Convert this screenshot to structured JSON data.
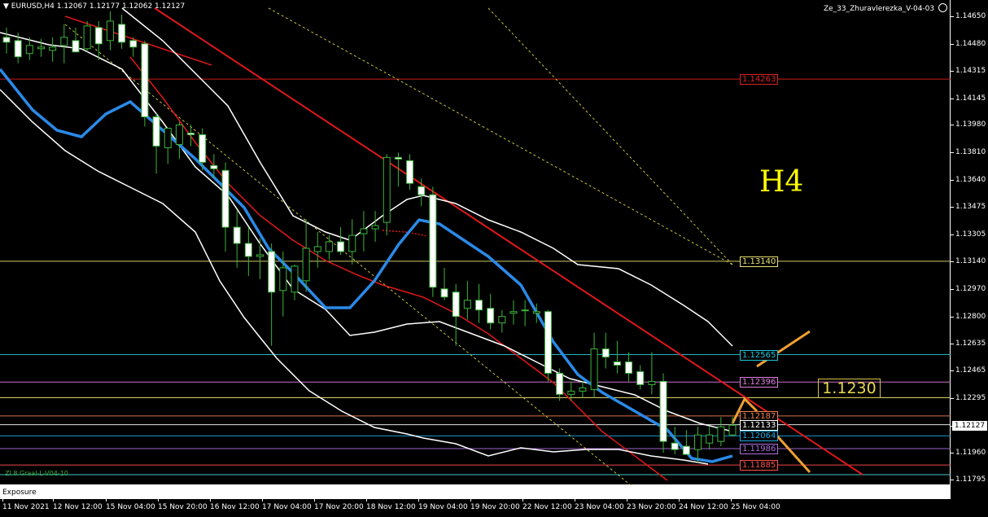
{
  "header": {
    "arrow": "▼",
    "symbol": "EURUSD,H4",
    "ohlc": "1.12067 1.12177 1.12062 1.12127"
  },
  "indicator": {
    "name": "Ze_33_Zhuravlerezka_V-04-03",
    "icon": "smiley-icon"
  },
  "timeframe_label": "H4",
  "target_label": "1.1230",
  "current_price": "1.12127",
  "indicator_label": "ZI 8 Graal-L-V04-10",
  "sub_panel": {
    "tab": "Exposure"
  },
  "price_axis": {
    "ticks": [
      "1.14650",
      "1.14480",
      "1.14315",
      "1.14145",
      "1.13980",
      "1.13810",
      "1.13640",
      "1.13475",
      "1.13305",
      "1.13140",
      "1.12970",
      "1.12800",
      "1.12635",
      "1.12465",
      "1.12295",
      "1.12127",
      "1.11960",
      "1.11795"
    ]
  },
  "levels": [
    {
      "value": "1.14263",
      "color": "#e02020"
    },
    {
      "value": "1.13140",
      "color": "#e8e070"
    },
    {
      "value": "1.12565",
      "color": "#20c8d8"
    },
    {
      "value": "1.12396",
      "color": "#e080e0"
    },
    {
      "value": "1.12187",
      "color": "#f08050"
    },
    {
      "value": "1.12133",
      "color": "#ffffff"
    },
    {
      "value": "1.12064",
      "color": "#20a8e0"
    },
    {
      "value": "1.11986",
      "color": "#b070e0"
    },
    {
      "value": "1.11885",
      "color": "#ff5050"
    }
  ],
  "time_axis": [
    "11 Nov 2021",
    "12 Nov 12:00",
    "15 Nov 04:00",
    "15 Nov 20:00",
    "16 Nov 12:00",
    "17 Nov 04:00",
    "17 Nov 20:00",
    "18 Nov 12:00",
    "19 Nov 04:00",
    "19 Nov 20:00",
    "22 Nov 12:00",
    "23 Nov 04:00",
    "23 Nov 20:00",
    "24 Nov 12:00",
    "25 Nov 04:00"
  ],
  "chart_data": {
    "type": "candlestick",
    "symbol": "EURUSD",
    "timeframe": "H4",
    "ylim": [
      1.1176,
      1.1475
    ],
    "candles": [
      {
        "o": 1.1452,
        "h": 1.1458,
        "l": 1.1442,
        "c": 1.1449
      },
      {
        "o": 1.145,
        "h": 1.1455,
        "l": 1.1436,
        "c": 1.144
      },
      {
        "o": 1.1442,
        "h": 1.1452,
        "l": 1.1438,
        "c": 1.1447
      },
      {
        "o": 1.1445,
        "h": 1.1451,
        "l": 1.144,
        "c": 1.1446
      },
      {
        "o": 1.1444,
        "h": 1.1452,
        "l": 1.1437,
        "c": 1.1446
      },
      {
        "o": 1.1447,
        "h": 1.146,
        "l": 1.1436,
        "c": 1.1452
      },
      {
        "o": 1.145,
        "h": 1.1458,
        "l": 1.1443,
        "c": 1.1443
      },
      {
        "o": 1.1445,
        "h": 1.1462,
        "l": 1.1443,
        "c": 1.1459
      },
      {
        "o": 1.1458,
        "h": 1.1462,
        "l": 1.1438,
        "c": 1.1448
      },
      {
        "o": 1.145,
        "h": 1.1468,
        "l": 1.1444,
        "c": 1.1462
      },
      {
        "o": 1.146,
        "h": 1.1466,
        "l": 1.1445,
        "c": 1.1449
      },
      {
        "o": 1.145,
        "h": 1.1452,
        "l": 1.144,
        "c": 1.1446
      },
      {
        "o": 1.1448,
        "h": 1.145,
        "l": 1.1397,
        "c": 1.1403
      },
      {
        "o": 1.1403,
        "h": 1.1405,
        "l": 1.1368,
        "c": 1.1385
      },
      {
        "o": 1.1384,
        "h": 1.1395,
        "l": 1.1374,
        "c": 1.1396
      },
      {
        "o": 1.1386,
        "h": 1.14,
        "l": 1.1377,
        "c": 1.1398
      },
      {
        "o": 1.1393,
        "h": 1.1398,
        "l": 1.1385,
        "c": 1.1392
      },
      {
        "o": 1.1392,
        "h": 1.1396,
        "l": 1.137,
        "c": 1.1375
      },
      {
        "o": 1.1373,
        "h": 1.138,
        "l": 1.1365,
        "c": 1.1371
      },
      {
        "o": 1.137,
        "h": 1.1375,
        "l": 1.132,
        "c": 1.1335
      },
      {
        "o": 1.1335,
        "h": 1.1345,
        "l": 1.131,
        "c": 1.1325
      },
      {
        "o": 1.1325,
        "h": 1.1335,
        "l": 1.1305,
        "c": 1.1317
      },
      {
        "o": 1.1317,
        "h": 1.1328,
        "l": 1.1303,
        "c": 1.1318
      },
      {
        "o": 1.132,
        "h": 1.1325,
        "l": 1.1262,
        "c": 1.1295
      },
      {
        "o": 1.1296,
        "h": 1.132,
        "l": 1.128,
        "c": 1.131
      },
      {
        "o": 1.1295,
        "h": 1.1312,
        "l": 1.129,
        "c": 1.1311
      },
      {
        "o": 1.1302,
        "h": 1.134,
        "l": 1.1295,
        "c": 1.1322
      },
      {
        "o": 1.132,
        "h": 1.1332,
        "l": 1.131,
        "c": 1.1323
      },
      {
        "o": 1.132,
        "h": 1.133,
        "l": 1.1315,
        "c": 1.1326
      },
      {
        "o": 1.1326,
        "h": 1.1335,
        "l": 1.1318,
        "c": 1.132
      },
      {
        "o": 1.132,
        "h": 1.134,
        "l": 1.1312,
        "c": 1.133
      },
      {
        "o": 1.1331,
        "h": 1.1345,
        "l": 1.132,
        "c": 1.1334
      },
      {
        "o": 1.1334,
        "h": 1.1345,
        "l": 1.1326,
        "c": 1.1336
      },
      {
        "o": 1.1338,
        "h": 1.138,
        "l": 1.133,
        "c": 1.1378
      },
      {
        "o": 1.1378,
        "h": 1.1381,
        "l": 1.136,
        "c": 1.1377
      },
      {
        "o": 1.1376,
        "h": 1.138,
        "l": 1.1358,
        "c": 1.1362
      },
      {
        "o": 1.136,
        "h": 1.1365,
        "l": 1.1348,
        "c": 1.1355
      },
      {
        "o": 1.1355,
        "h": 1.136,
        "l": 1.1292,
        "c": 1.1298
      },
      {
        "o": 1.1297,
        "h": 1.131,
        "l": 1.129,
        "c": 1.1292
      },
      {
        "o": 1.1295,
        "h": 1.13,
        "l": 1.1262,
        "c": 1.128
      },
      {
        "o": 1.1285,
        "h": 1.1302,
        "l": 1.1278,
        "c": 1.129
      },
      {
        "o": 1.129,
        "h": 1.13,
        "l": 1.1276,
        "c": 1.1284
      },
      {
        "o": 1.1285,
        "h": 1.1294,
        "l": 1.1272,
        "c": 1.1276
      },
      {
        "o": 1.1276,
        "h": 1.1284,
        "l": 1.127,
        "c": 1.128
      },
      {
        "o": 1.1282,
        "h": 1.129,
        "l": 1.1275,
        "c": 1.1283
      },
      {
        "o": 1.1284,
        "h": 1.129,
        "l": 1.1274,
        "c": 1.1284
      },
      {
        "o": 1.1282,
        "h": 1.1288,
        "l": 1.1276,
        "c": 1.1283
      },
      {
        "o": 1.1283,
        "h": 1.1284,
        "l": 1.124,
        "c": 1.1245
      },
      {
        "o": 1.1245,
        "h": 1.1248,
        "l": 1.1228,
        "c": 1.1232
      },
      {
        "o": 1.1232,
        "h": 1.124,
        "l": 1.1228,
        "c": 1.1234
      },
      {
        "o": 1.1234,
        "h": 1.124,
        "l": 1.123,
        "c": 1.1236
      },
      {
        "o": 1.1235,
        "h": 1.127,
        "l": 1.123,
        "c": 1.126
      },
      {
        "o": 1.126,
        "h": 1.127,
        "l": 1.1248,
        "c": 1.1255
      },
      {
        "o": 1.1252,
        "h": 1.1265,
        "l": 1.1245,
        "c": 1.125
      },
      {
        "o": 1.1252,
        "h": 1.1258,
        "l": 1.124,
        "c": 1.1245
      },
      {
        "o": 1.1246,
        "h": 1.125,
        "l": 1.1235,
        "c": 1.1238
      },
      {
        "o": 1.1238,
        "h": 1.1258,
        "l": 1.1232,
        "c": 1.124
      },
      {
        "o": 1.124,
        "h": 1.1245,
        "l": 1.1196,
        "c": 1.1203
      },
      {
        "o": 1.1202,
        "h": 1.1212,
        "l": 1.1195,
        "c": 1.1198
      },
      {
        "o": 1.12,
        "h": 1.121,
        "l": 1.1195,
        "c": 1.1195
      },
      {
        "o": 1.1198,
        "h": 1.1212,
        "l": 1.119,
        "c": 1.1207
      },
      {
        "o": 1.1202,
        "h": 1.1212,
        "l": 1.1198,
        "c": 1.1207
      },
      {
        "o": 1.1203,
        "h": 1.1218,
        "l": 1.12,
        "c": 1.1212
      },
      {
        "o": 1.1207,
        "h": 1.1218,
        "l": 1.1206,
        "c": 1.1213
      }
    ]
  }
}
